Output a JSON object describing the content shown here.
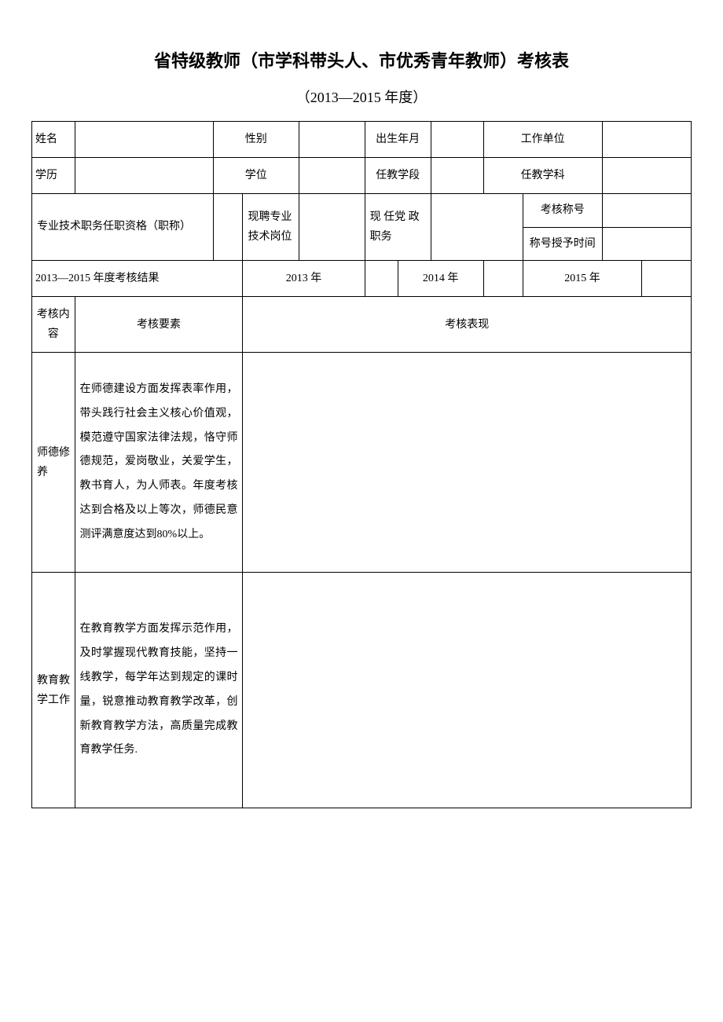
{
  "title": "省特级教师（市学科带头人、市优秀青年教师）考核表",
  "subtitle": "（2013—2015 年度）",
  "labels": {
    "name": "姓名",
    "gender": "性别",
    "birth": "出生年月",
    "work_unit": "工作单位",
    "education": "学历",
    "degree": "学位",
    "teaching_stage": "任教学段",
    "teaching_subject": "任教学科",
    "prof_title": "专业技术职务任职资格（职称）",
    "current_prof_post": "现聘专业技术岗位",
    "party_post": "现 任党 政职务",
    "assess_title": "考核称号",
    "title_grant_time": "称号授予时间",
    "results_label": "2013—2015 年度考核结果",
    "y2013": "2013 年",
    "y2014": "2014 年",
    "y2015": "2015 年",
    "assess_content": "考核内容",
    "assess_elements": "考核要素",
    "assess_perf": "考核表现"
  },
  "rows": [
    {
      "content": "师德修养",
      "elements": "在师德建设方面发挥表率作用，带头践行社会主义核心价值观，模范遵守国家法律法规，恪守师德规范，爱岗敬业，关爱学生，教书育人，为人师表。年度考核达到合格及以上等次，师德民意测评满意度达到80%以上。"
    },
    {
      "content": "教育教学工作",
      "elements": "在教育教学方面发挥示范作用，及时掌握现代教育技能，坚持一线教学，每学年达到规定的课时量，锐意推动教育教学改革，创新教育教学方法，高质量完成教育教学任务."
    }
  ]
}
